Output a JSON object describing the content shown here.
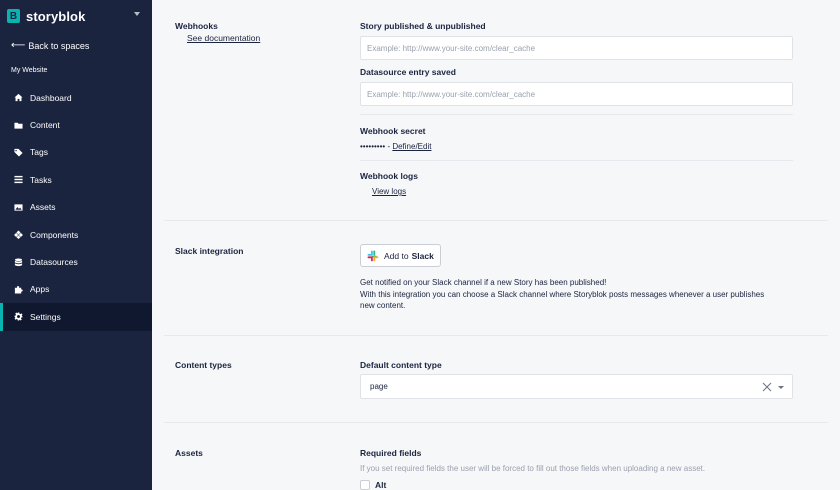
{
  "sidebar": {
    "brand": {
      "logo_letter": "B",
      "name": "storyblok"
    },
    "back_label": "Back to spaces",
    "space_name": "My Website",
    "items": [
      {
        "label": "Dashboard",
        "icon": "home-icon"
      },
      {
        "label": "Content",
        "icon": "folder-icon"
      },
      {
        "label": "Tags",
        "icon": "tags-icon"
      },
      {
        "label": "Tasks",
        "icon": "tasks-icon"
      },
      {
        "label": "Assets",
        "icon": "image-icon"
      },
      {
        "label": "Components",
        "icon": "components-icon"
      },
      {
        "label": "Datasources",
        "icon": "database-icon"
      },
      {
        "label": "Apps",
        "icon": "puzzle-icon"
      },
      {
        "label": "Settings",
        "icon": "gear-icon",
        "active": true
      }
    ]
  },
  "webhooks": {
    "title": "Webhooks",
    "doc_link": "See documentation",
    "story_label": "Story published & unpublished",
    "story_placeholder": "Example: http://www.your-site.com/clear_cache",
    "datasource_label": "Datasource entry saved",
    "datasource_placeholder": "Example: http://www.your-site.com/clear_cache",
    "secret_label": "Webhook secret",
    "secret_mask": "•••••••••",
    "secret_sep": " - ",
    "secret_link": "Define/Edit",
    "logs_label": "Webhook logs",
    "logs_link": "View logs"
  },
  "slack": {
    "title": "Slack integration",
    "button_prefix": "Add to",
    "button_brand": "Slack",
    "line1": "Get notified on your Slack channel if a new Story has been published!",
    "line2": "With this integration you can choose a Slack channel where Storyblok posts messages whenever a user publishes",
    "line3": "new content."
  },
  "content_types": {
    "title": "Content types",
    "default_label": "Default content type",
    "default_value": "page"
  },
  "assets": {
    "title": "Assets",
    "required_label": "Required fields",
    "required_help": "If you set required fields the user will be forced to fill out those fields when uploading a new asset.",
    "alt_label": "Alt"
  },
  "colors": {
    "sidebar_bg": "#1b243f",
    "accent": "#09b3af",
    "page_bg": "#f6f7f9"
  }
}
